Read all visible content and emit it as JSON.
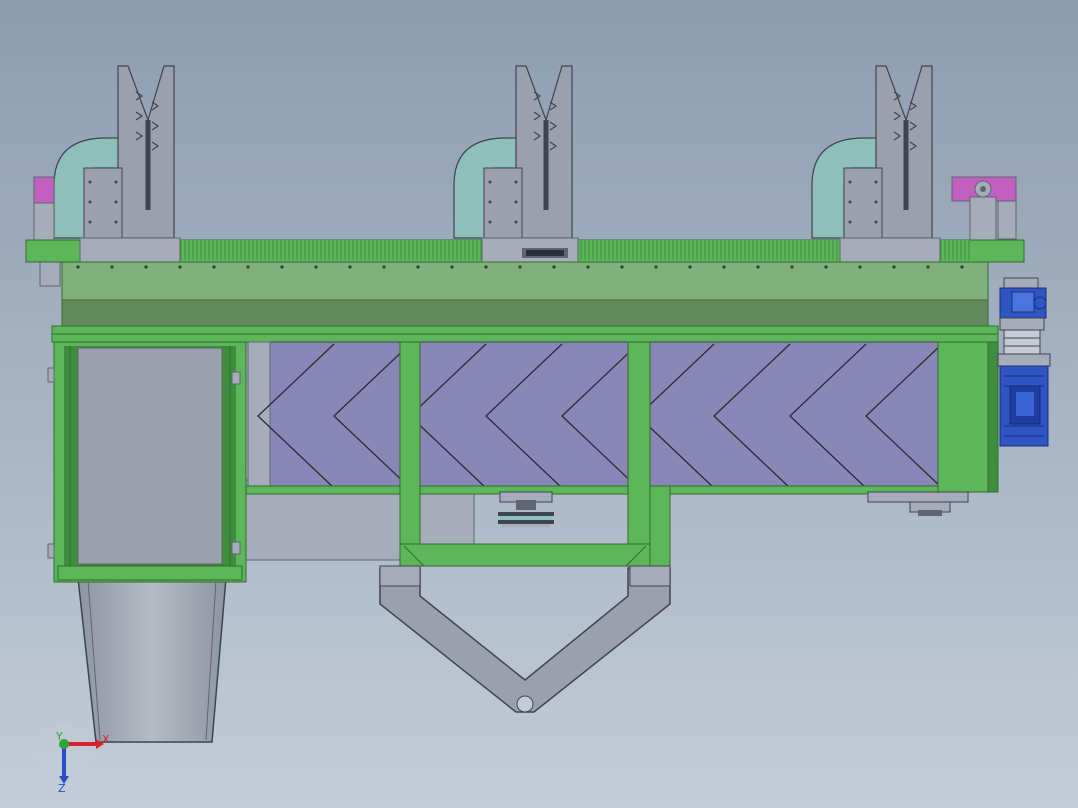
{
  "viewport": {
    "background_top": "#8d9db0",
    "background_bottom": "#c3cdd8"
  },
  "colors": {
    "frame_green": "#5db65a",
    "frame_green_dark": "#3f8e3e",
    "top_green": "#82b07c",
    "screen_violet": "#8987b6",
    "steel_grey": "#9aa0ac",
    "steel_dark": "#5f6571",
    "duct_teal": "#8ebfb9",
    "pad_magenta": "#c35fbf",
    "motor_blue": "#2f55c4"
  },
  "triad": {
    "x_label": "X",
    "y_label": "Y",
    "z_label": "Z",
    "x_color": "#d4242a",
    "y_color": "#2fa43a",
    "z_color": "#2b4bc9"
  },
  "screen_panels": 3
}
